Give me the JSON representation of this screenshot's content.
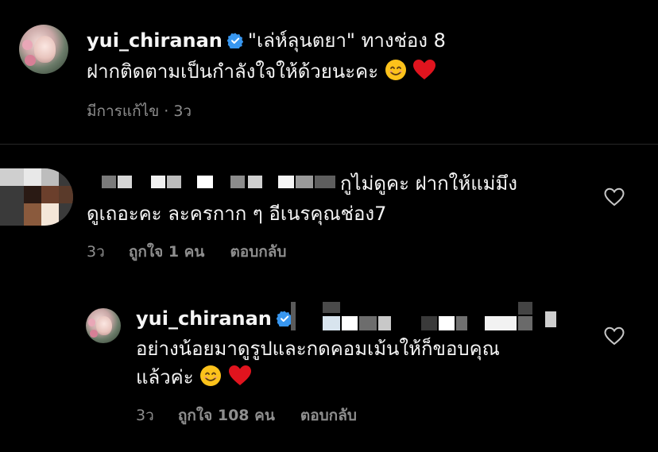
{
  "post": {
    "username": "yui_chiranan",
    "caption_line1": "\"เล่ห์ลุนตยา\" ทางช่อง 8",
    "caption_line2": "ฝากติดตามเป็นกำลังใจให้ด้วยนะคะ",
    "edited_label": "มีการแก้ไข",
    "time": "3ว"
  },
  "comment": {
    "text_line1": "กูไม่ดูคะ ฝากให้แม่มึง",
    "text_line2": "ดูเถอะคะ ละครกาก ๆ อีเนรคุณช่อง7",
    "time": "3ว",
    "likes_label": "ถูกใจ 1 คน",
    "reply_label": "ตอบกลับ"
  },
  "reply": {
    "username": "yui_chiranan",
    "text_line1": "อย่างน้อยมาดูรูปและกดคอมเม้นให้ก็ขอบคุณ",
    "text_line2": "แล้วค่ะ",
    "time": "3ว",
    "likes_label": "ถูกใจ 108 คน",
    "reply_label": "ตอบกลับ"
  },
  "icons": {
    "verified": "verified-badge-icon",
    "like": "heart-outline-icon",
    "emoji_smile": "smiling-face-emoji",
    "emoji_heart": "red-heart-emoji"
  },
  "colors": {
    "background": "#000000",
    "text": "#f5f5f5",
    "muted": "#8e8e8e",
    "verified": "#3897f0",
    "heart_red": "#e0141e"
  }
}
